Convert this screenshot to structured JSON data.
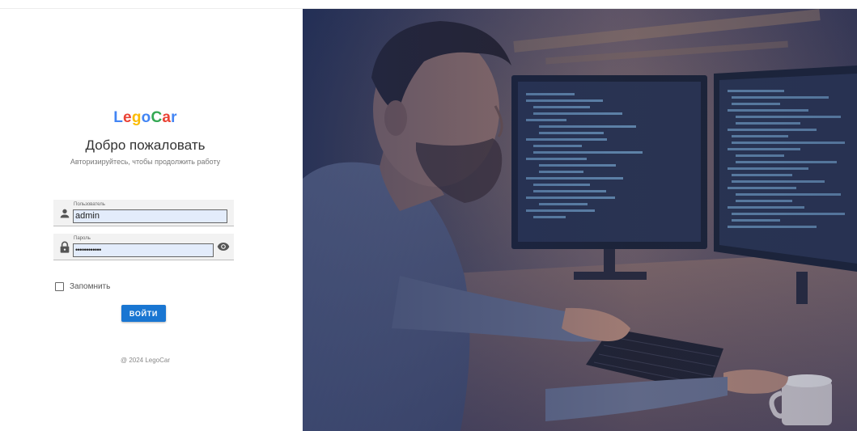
{
  "brand": {
    "name": "LegoCar",
    "letters": [
      "L",
      "e",
      "g",
      "o",
      "C",
      "a",
      "r"
    ],
    "colors": [
      "#4285F4",
      "#EA4335",
      "#FBBC05",
      "#4285F4",
      "#34A853",
      "#EA4335",
      "#4285F4"
    ]
  },
  "login": {
    "title": "Добро пожаловать",
    "subtitle": "Авторизируйтесь, чтобы продолжить работу",
    "username": {
      "label": "Пользователь",
      "value": "admin",
      "icon": "person-icon"
    },
    "password": {
      "label": "Пароль",
      "value": "••••••••••••",
      "icon": "lock-icon",
      "toggle_icon": "eye-icon"
    },
    "remember_label": "Запомнить",
    "remember_checked": false,
    "submit_label": "ВОЙТИ"
  },
  "footer": {
    "copyright": "@ 2024 LegoCar"
  },
  "colors": {
    "accent": "#1976d2",
    "field_bg": "#f2f2f2",
    "input_bg": "#e3ecfb"
  },
  "hero": {
    "description_icon": "developer-photo"
  }
}
